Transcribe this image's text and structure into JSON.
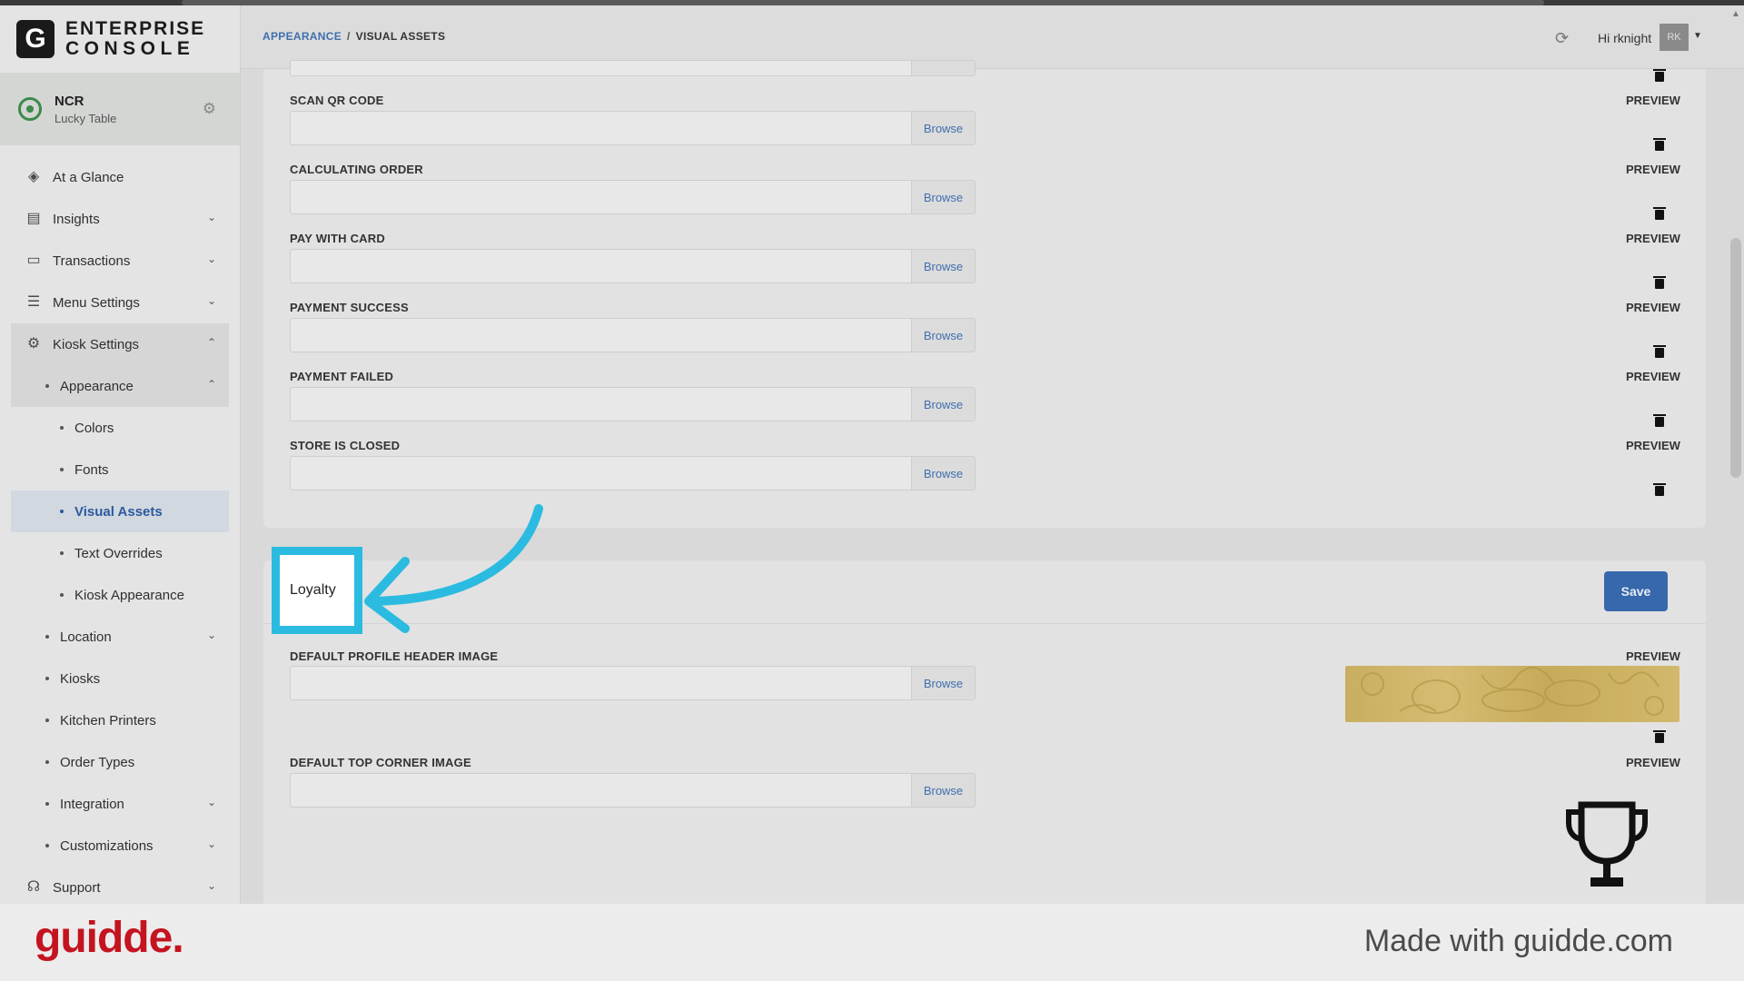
{
  "brand": {
    "logo_letter": "G",
    "line1": "ENTERPRISE",
    "line2": "CONSOLE"
  },
  "org": {
    "name": "NCR",
    "sub": "Lucky Table"
  },
  "nav": {
    "at_a_glance": "At a Glance",
    "insights": "Insights",
    "transactions": "Transactions",
    "menu_settings": "Menu Settings",
    "kiosk_settings": "Kiosk Settings",
    "appearance": "Appearance",
    "colors": "Colors",
    "fonts": "Fonts",
    "visual_assets": "Visual Assets",
    "text_overrides": "Text Overrides",
    "kiosk_appearance": "Kiosk Appearance",
    "location": "Location",
    "kiosks": "Kiosks",
    "kitchen_printers": "Kitchen Printers",
    "order_types": "Order Types",
    "integration": "Integration",
    "customizations": "Customizations",
    "support": "Support"
  },
  "header": {
    "breadcrumb_link": "APPEARANCE",
    "breadcrumb_sep": "/",
    "breadcrumb_current": "VISUAL ASSETS",
    "greeting": "Hi rknight",
    "avatar_initials": "RK"
  },
  "fields": {
    "browse_label": "Browse",
    "preview_label": "PREVIEW",
    "scan_qr": "SCAN QR CODE",
    "calculating": "CALCULATING ORDER",
    "pay_card": "PAY WITH CARD",
    "pay_success": "PAYMENT SUCCESS",
    "pay_failed": "PAYMENT FAILED",
    "store_closed": "STORE IS CLOSED",
    "profile_header": "DEFAULT PROFILE HEADER IMAGE",
    "top_corner": "DEFAULT TOP CORNER IMAGE"
  },
  "loyalty": {
    "title": "Loyalty",
    "save_label": "Save"
  },
  "footer": {
    "brand": "guidde.",
    "made_with": "Made with guidde.com"
  },
  "colors": {
    "accent": "#3768ac",
    "highlight": "#2bbbe0",
    "brand_red": "#c4141f"
  }
}
